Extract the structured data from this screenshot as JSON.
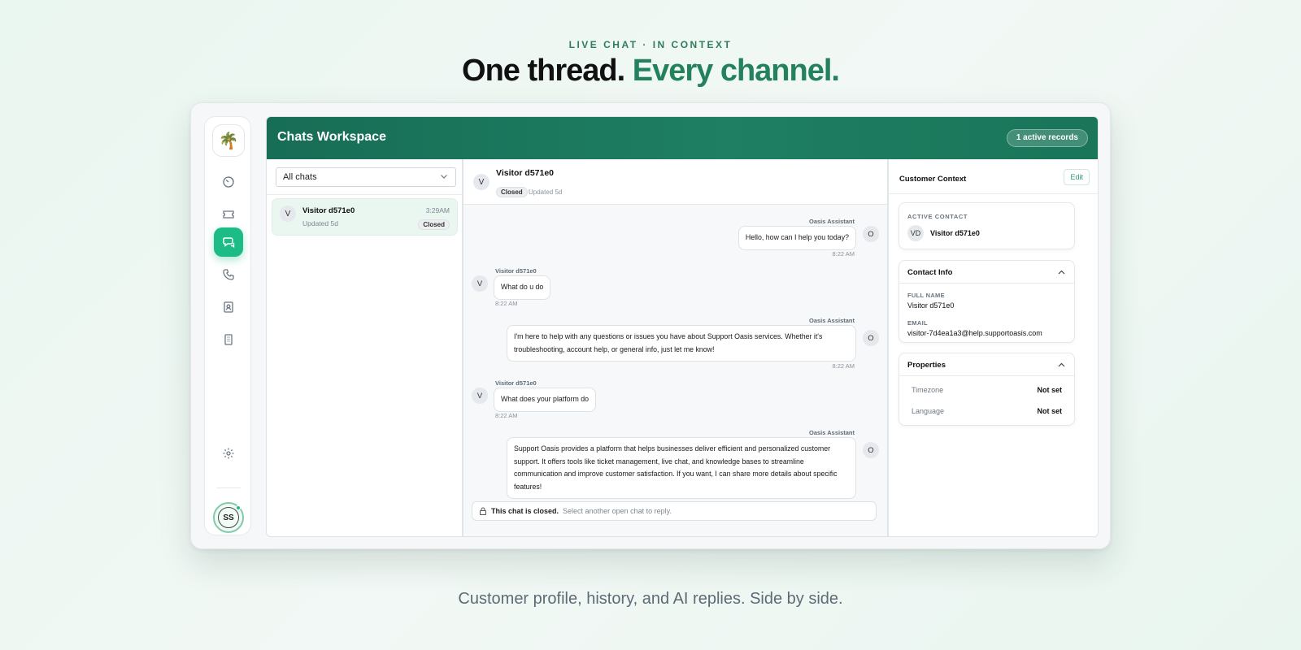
{
  "hero": {
    "eyebrow": "LIVE CHAT · IN CONTEXT",
    "headline_dark": "One thread.",
    "headline_green": "Every channel.",
    "tagline": "Customer profile, history, and AI replies. Side by side."
  },
  "colors": {
    "brand_green": "#1e7f62",
    "accent_green": "#1dbb86",
    "headline_green": "#23815e"
  },
  "rail": {
    "logo_icon": "🌴",
    "items": [
      {
        "icon": "dashboard-gauge-icon",
        "active": false
      },
      {
        "icon": "ticket-icon",
        "active": false
      },
      {
        "icon": "chat-bubbles-icon",
        "active": true
      },
      {
        "icon": "phone-icon",
        "active": false
      },
      {
        "icon": "contacts-book-icon",
        "active": false
      },
      {
        "icon": "building-icon",
        "active": false
      }
    ],
    "settings_icon": "gear-icon",
    "user_initials": "SS"
  },
  "app": {
    "title": "Chats Workspace",
    "active_records": "1 active records"
  },
  "chat_list": {
    "filter_value": "All chats",
    "items": [
      {
        "initial": "V",
        "name": "Visitor d571e0",
        "time": "3:29AM",
        "updated": "Updated 5d",
        "status": "Closed"
      }
    ]
  },
  "conversation": {
    "initial": "V",
    "name": "Visitor d571e0",
    "status": "Closed",
    "updated": "Updated 5d",
    "messages": [
      {
        "side": "agent",
        "sender": "Oasis Assistant",
        "initial": "O",
        "text": "Hello, how can I help you today?",
        "time": "8:22 AM"
      },
      {
        "side": "visitor",
        "sender": "Visitor d571e0",
        "initial": "V",
        "text": "What do u do",
        "time": "8:22 AM"
      },
      {
        "side": "agent",
        "sender": "Oasis Assistant",
        "initial": "O",
        "text": "I'm here to help with any questions or issues you have about Support Oasis services. Whether it's troubleshooting, account help, or general info, just let me know!",
        "time": "8:22 AM"
      },
      {
        "side": "visitor",
        "sender": "Visitor d571e0",
        "initial": "V",
        "text": "What does your platform do",
        "time": "8:22 AM"
      },
      {
        "side": "agent",
        "sender": "Oasis Assistant",
        "initial": "O",
        "text": "Support Oasis provides a platform that helps businesses deliver efficient and personalized customer support. It offers tools like ticket management, live chat, and knowledge bases to streamline communication and improve customer satisfaction. If you want, I can share more details about specific features!",
        "time": ""
      }
    ],
    "closed_bold": "This chat is closed.",
    "closed_hint": "Select another open chat to reply."
  },
  "context": {
    "title": "Customer Context",
    "edit_label": "Edit",
    "active_contact_label": "ACTIVE CONTACT",
    "contact_initials": "VD",
    "contact_name": "Visitor d571e0",
    "contact_info_title": "Contact Info",
    "full_name_label": "FULL NAME",
    "full_name": "Visitor d571e0",
    "email_label": "EMAIL",
    "email": "visitor-7d4ea1a3@help.supportoasis.com",
    "properties_title": "Properties",
    "properties": [
      {
        "key": "Timezone",
        "value": "Not set"
      },
      {
        "key": "Language",
        "value": "Not set"
      }
    ]
  }
}
